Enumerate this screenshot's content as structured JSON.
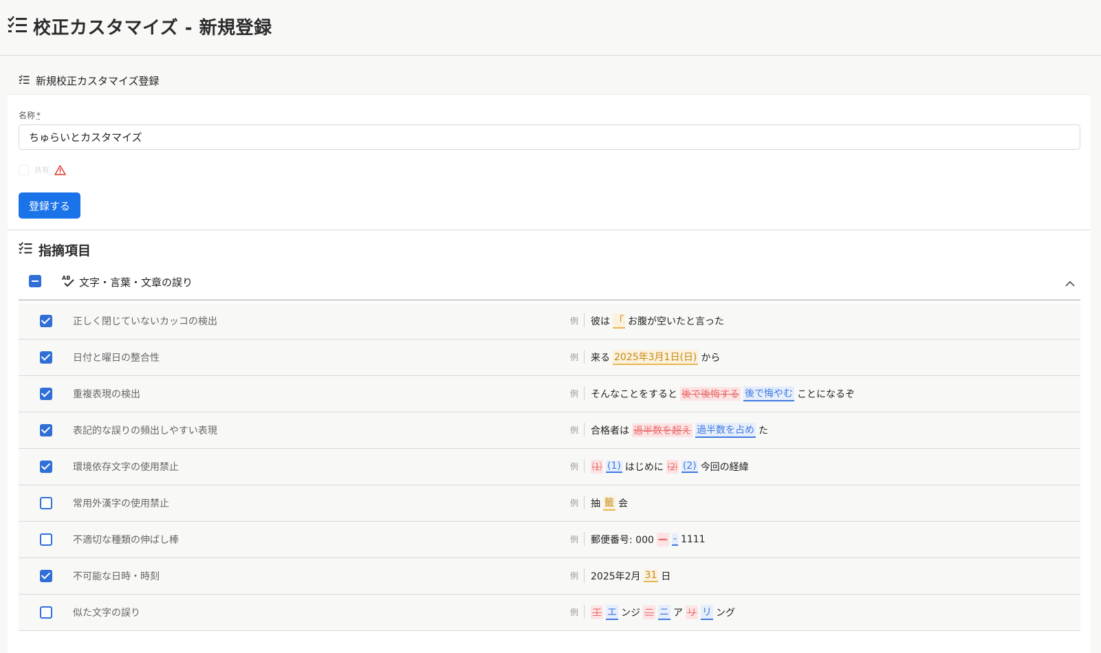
{
  "page": {
    "title": "校正カスタマイズ - 新規登録"
  },
  "form": {
    "header": "新規校正カスタマイズ登録",
    "name_label": "名称",
    "required_mark": "*",
    "name_value": "ちゅらいとカスタマイズ",
    "share_label": "共有",
    "share_checked": false,
    "submit_label": "登録する"
  },
  "section": {
    "title": "指摘項目"
  },
  "category": {
    "label": "文字・言葉・文章の誤り",
    "state": "indeterminate",
    "expanded": true
  },
  "example_label": "例",
  "items": [
    {
      "label": "正しく閉じていないカッコの検出",
      "checked": true,
      "example": [
        {
          "t": "彼は"
        },
        {
          "t": "「",
          "s": "y"
        },
        {
          "t": "お腹が空いたと言った"
        }
      ]
    },
    {
      "label": "日付と曜日の整合性",
      "checked": true,
      "example": [
        {
          "t": "来る"
        },
        {
          "t": "2025年3月1日(日)",
          "s": "y"
        },
        {
          "t": "から"
        }
      ]
    },
    {
      "label": "重複表現の検出",
      "checked": true,
      "example": [
        {
          "t": "そんなことをすると"
        },
        {
          "t": "後で後悔する",
          "s": "r"
        },
        {
          "t": "後で悔やむ",
          "s": "b"
        },
        {
          "t": "ことになるぞ"
        }
      ]
    },
    {
      "label": "表記的な誤りの頻出しやすい表現",
      "checked": true,
      "example": [
        {
          "t": "合格者は"
        },
        {
          "t": "過半数を超え",
          "s": "r"
        },
        {
          "t": "過半数を占め",
          "s": "b"
        },
        {
          "t": "た"
        }
      ]
    },
    {
      "label": "環境依存文字の使用禁止",
      "checked": true,
      "example": [
        {
          "t": "⑴",
          "s": "r"
        },
        {
          "t": "(1)",
          "s": "b"
        },
        {
          "t": "はじめに"
        },
        {
          "t": "⑵",
          "s": "r"
        },
        {
          "t": "(2)",
          "s": "b"
        },
        {
          "t": "今回の経緯"
        }
      ]
    },
    {
      "label": "常用外漢字の使用禁止",
      "checked": false,
      "example": [
        {
          "t": "抽"
        },
        {
          "t": "籤",
          "s": "y"
        },
        {
          "t": "会"
        }
      ]
    },
    {
      "label": "不適切な種類の伸ばし棒",
      "checked": false,
      "example": [
        {
          "t": "郵便番号: 000"
        },
        {
          "t": "ー",
          "s": "r"
        },
        {
          "t": "-",
          "s": "b"
        },
        {
          "t": "1111"
        }
      ]
    },
    {
      "label": "不可能な日時・時刻",
      "checked": true,
      "example": [
        {
          "t": "2025年2月"
        },
        {
          "t": "31",
          "s": "y"
        },
        {
          "t": "日"
        }
      ]
    },
    {
      "label": "似た文字の誤り",
      "checked": false,
      "example": [
        {
          "t": "工",
          "s": "r"
        },
        {
          "t": "エ",
          "s": "b"
        },
        {
          "t": "ンジ"
        },
        {
          "t": "二",
          "s": "r"
        },
        {
          "t": "ニ",
          "s": "b"
        },
        {
          "t": "ア"
        },
        {
          "t": "リ",
          "s": "r"
        },
        {
          "t": "リ",
          "s": "b"
        },
        {
          "t": "ング"
        }
      ]
    }
  ],
  "colors": {
    "primary": "#1a73e8",
    "checkbox": "#2f6fd6",
    "highlight_warning": "#e8b64c",
    "highlight_delete": "#e86a6a",
    "highlight_suggest": "#3d78e0",
    "warning_icon": "#d93025"
  },
  "icons": {
    "title": "checklist-icon",
    "category": "spellcheck-icon",
    "collapse": "chevron-up-icon",
    "warning": "warning-icon"
  }
}
